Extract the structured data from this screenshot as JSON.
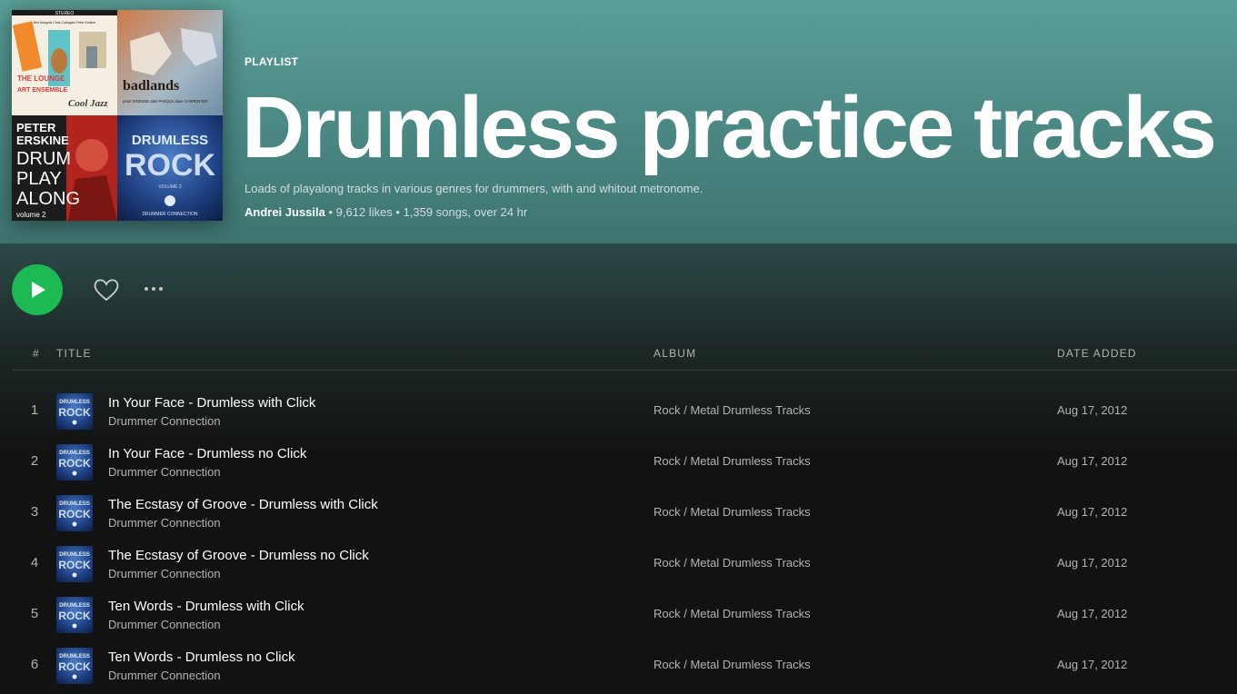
{
  "header": {
    "type_label": "PLAYLIST",
    "title": "Drumless practice tracks",
    "description": "Loads of playalong tracks in various genres for drummers, with and whitout metronome.",
    "owner": "Andrei Jussila",
    "likes": "9,612 likes",
    "stats": "1,359 songs, over 24 hr",
    "separator": " • "
  },
  "cover": {
    "tile1": {
      "top": "STEREO",
      "names": "Ben Margolis  Chris Colangelo  Peter Erskine",
      "title1": "THE LOUNGE",
      "title2": "ART ENSEMBLE",
      "title3": "Cool Jazz"
    },
    "tile2": {
      "title": "badlands",
      "names": "peter ERSKINE  alan PASQUA  dave CARPENTER"
    },
    "tile3": {
      "line1": "PETER",
      "line2": "ERSKINE",
      "line3": "DRUM",
      "line4": "PLAY",
      "line5": "ALONG",
      "line6": "volume 2"
    },
    "tile4": {
      "line1": "DRUMLESS",
      "line2": "ROCK",
      "line3": "VOLUME 2",
      "line4": "DRUMMER CONNECTION"
    }
  },
  "controls": {
    "play": "play-icon",
    "like": "heart-icon",
    "more": "more-icon"
  },
  "table": {
    "headers": {
      "number": "#",
      "title": "TITLE",
      "album": "ALBUM",
      "date": "DATE ADDED"
    },
    "thumb_text": {
      "line1": "DRUMLESS",
      "line2": "ROCK"
    },
    "rows": [
      {
        "num": "1",
        "title": "In Your Face - Drumless with Click",
        "artist": "Drummer Connection",
        "album": "Rock / Metal Drumless Tracks",
        "date": "Aug 17, 2012"
      },
      {
        "num": "2",
        "title": "In Your Face - Drumless no Click",
        "artist": "Drummer Connection",
        "album": "Rock / Metal Drumless Tracks",
        "date": "Aug 17, 2012"
      },
      {
        "num": "3",
        "title": "The Ecstasy of Groove - Drumless with Click",
        "artist": "Drummer Connection",
        "album": "Rock / Metal Drumless Tracks",
        "date": "Aug 17, 2012"
      },
      {
        "num": "4",
        "title": "The Ecstasy of Groove - Drumless no Click",
        "artist": "Drummer Connection",
        "album": "Rock / Metal Drumless Tracks",
        "date": "Aug 17, 2012"
      },
      {
        "num": "5",
        "title": "Ten Words - Drumless with Click",
        "artist": "Drummer Connection",
        "album": "Rock / Metal Drumless Tracks",
        "date": "Aug 17, 2012"
      },
      {
        "num": "6",
        "title": "Ten Words - Drumless no Click",
        "artist": "Drummer Connection",
        "album": "Rock / Metal Drumless Tracks",
        "date": "Aug 17, 2012"
      }
    ]
  },
  "colors": {
    "accent": "#1db954",
    "header_bg": "#5a9f98",
    "page_bg": "#121212",
    "muted_text": "#b3b3b3"
  }
}
